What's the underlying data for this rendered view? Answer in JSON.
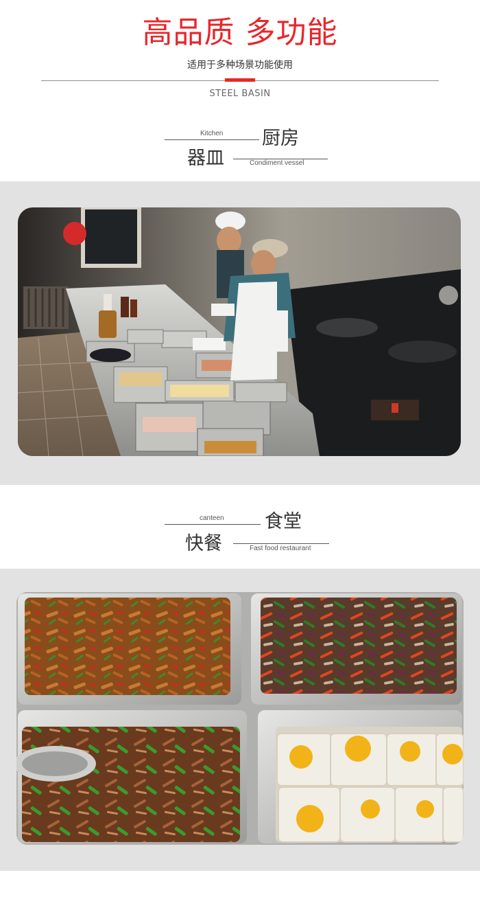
{
  "header": {
    "title": "高品质 多功能",
    "subtitle": "适用于多种场景功能使用",
    "en": "STEEL BASIN"
  },
  "section1": {
    "en_top": "Kitchen",
    "cn_right": "厨房",
    "cn_left": "器皿",
    "en_bottom": "Condiment vessel"
  },
  "section2": {
    "en_top": "canteen",
    "cn_right": "食堂",
    "cn_left": "快餐",
    "en_bottom": "Fast food restaurant"
  },
  "colors": {
    "accent": "#e8262b",
    "band": "#e2e2e2"
  }
}
